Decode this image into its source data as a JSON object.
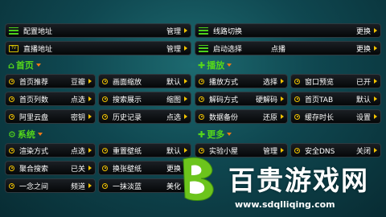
{
  "top_rows": [
    {
      "label": "配置地址",
      "value": "管理",
      "icon": "lines-icon"
    },
    {
      "label": "线路切换",
      "value": "更换",
      "icon": "lines-icon"
    },
    {
      "label": "直播地址",
      "value": "管理",
      "icon": "tv-icon"
    },
    {
      "label": "启动选择",
      "value": "点播",
      "value2": "更换",
      "icon": "lines-icon"
    }
  ],
  "sections": {
    "home": "首页",
    "play": "播放",
    "system": "系统",
    "more": "更多"
  },
  "home_rows": [
    {
      "label": "首页推荐",
      "value": "豆瓣"
    },
    {
      "label": "画面缩放",
      "value": "默认"
    },
    {
      "label": "首页列数",
      "value": "点选"
    },
    {
      "label": "搜索展示",
      "value": "缩图"
    },
    {
      "label": "阿里云盘",
      "value": "密钥"
    },
    {
      "label": "历史记录",
      "value": "点选"
    }
  ],
  "play_rows": [
    {
      "label": "播放方式",
      "value": "选择"
    },
    {
      "label": "窗口预览",
      "value": "已开"
    },
    {
      "label": "解码方式",
      "value": "硬解码"
    },
    {
      "label": "首页TAB",
      "value": "默认"
    },
    {
      "label": "数据备份",
      "value": "还原"
    },
    {
      "label": "缓存时长",
      "value": "设置"
    }
  ],
  "system_rows": [
    {
      "label": "渲染方式",
      "value": "点选"
    },
    {
      "label": "重置壁纸",
      "value": "默认"
    },
    {
      "label": "聚合搜索",
      "value": "已关"
    },
    {
      "label": "换张壁纸",
      "value": "更换"
    },
    {
      "label": "一念之间",
      "value": "频道"
    },
    {
      "label": "一抹淡蓝",
      "value": "美化"
    }
  ],
  "more_rows": [
    {
      "label": "实验小屋",
      "value": "管理"
    },
    {
      "label": "安全DNS",
      "value": "关闭"
    }
  ],
  "watermark": {
    "name": "百贵游戏网",
    "url": "www.sdqlliqing.com"
  },
  "colors": {
    "accent": "#f3c400",
    "green": "#55d61b",
    "chevron": "#f3c400",
    "background": "#0f4750"
  }
}
